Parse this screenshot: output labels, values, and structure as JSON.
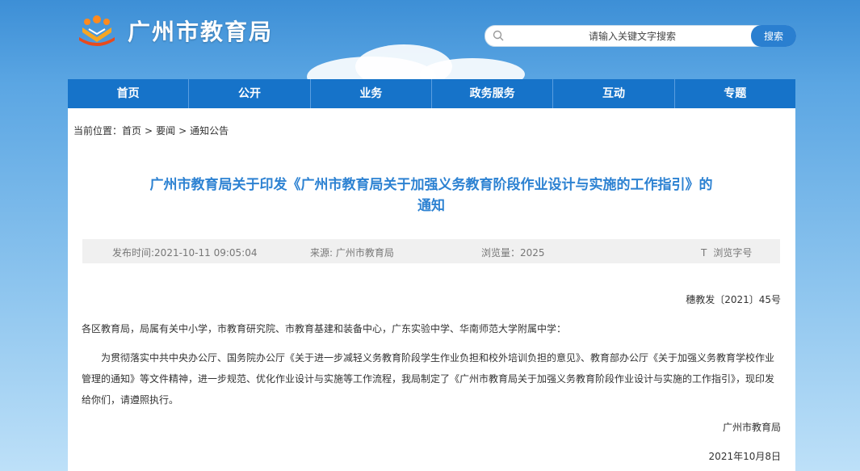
{
  "site": {
    "title": "广州市教育局"
  },
  "search": {
    "placeholder": "请输入关键文字搜索",
    "button_label": "搜索"
  },
  "nav": [
    "首页",
    "公开",
    "业务",
    "政务服务",
    "互动",
    "专题"
  ],
  "breadcrumb": {
    "label": "当前位置：",
    "items": [
      "首页",
      "要闻",
      "通知公告"
    ],
    "separator": ">"
  },
  "article": {
    "title_line1": "广州市教育局关于印发《广州市教育局关于加强义务教育阶段作业设计与实施的工作指引》的",
    "title_line2": "通知",
    "meta": {
      "publish_time": "发布时间:2021-10-11 09:05:04",
      "source_label": "来源:",
      "source_value": "广州市教育局",
      "views": "浏览量：2025",
      "font_size_icon": "T",
      "font_size_label": "浏览字号"
    },
    "doc_number": "穗教发〔2021〕45号",
    "addressee": "各区教育局，局属有关中小学，市教育研究院、市教育基建和装备中心，广东实验中学、华南师范大学附属中学：",
    "body": "为贯彻落实中共中央办公厅、国务院办公厅《关于进一步减轻义务教育阶段学生作业负担和校外培训负担的意见》、教育部办公厅《关于加强义务教育学校作业管理的通知》等文件精神，进一步规范、优化作业设计与实施等工作流程，我局制定了《广州市教育局关于加强义务教育阶段作业设计与实施的工作指引》，现印发给你们，请遵照执行。",
    "signer": "广州市教育局",
    "date": "2021年10月8日"
  },
  "colors": {
    "nav": "#1673c9",
    "title": "#2d82d2",
    "search_button": "#2a7fd0"
  }
}
